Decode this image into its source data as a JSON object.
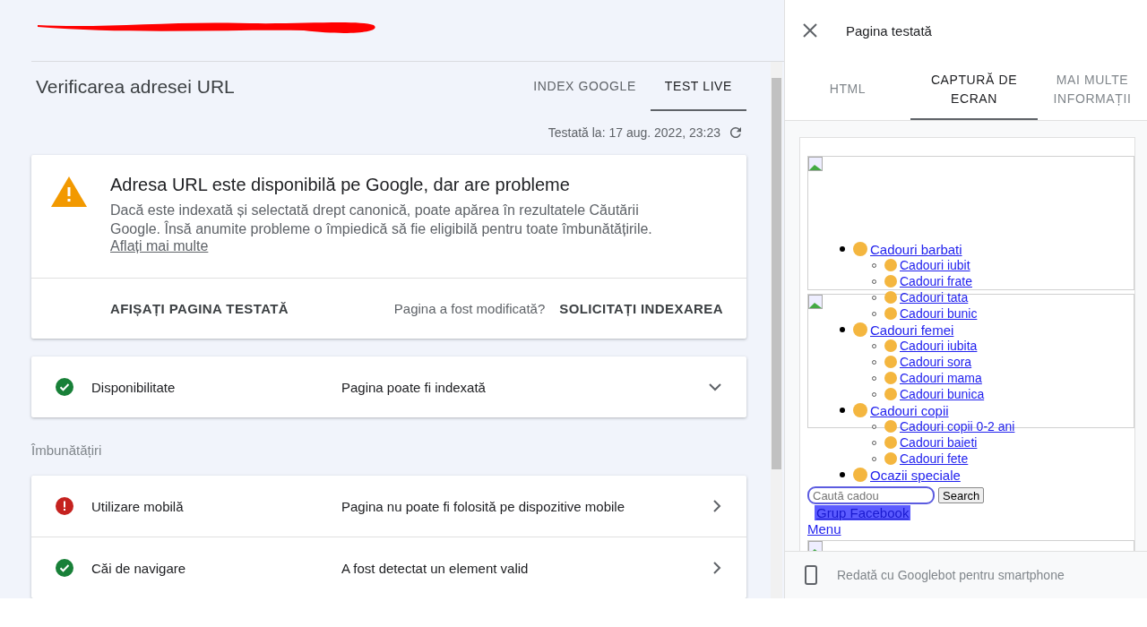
{
  "header": {
    "redacted_url": true
  },
  "inspection": {
    "title": "Verificarea adresei URL",
    "tabs": [
      {
        "label": "INDEX GOOGLE",
        "selected": false
      },
      {
        "label": "TEST LIVE",
        "selected": true
      }
    ],
    "tested_at": "Testată la: 17 aug. 2022, 23:23",
    "summary": {
      "has_issues": true,
      "heading": "Adresa URL este disponibilă pe Google, dar are probleme",
      "text": "Dacă este indexată și selectată drept canonică, poate apărea în rezultatele Căutării Google. Însă anumite probleme o împiedică să fie eligibilă pentru toate îmbunătățirile.",
      "link": "Aflați mai multe",
      "view_button": "AFIȘAȚI PAGINA TESTATĂ",
      "question": "Pagina a fost modificată?",
      "request_button": "SOLICITAȚI INDEXAREA"
    },
    "availability": [
      {
        "kind": "valid",
        "label": "Disponibilitate",
        "value": "Pagina poate fi indexată",
        "expandable": true
      }
    ],
    "enhancements_heading": "Îmbunătățiri",
    "enhancements": [
      {
        "kind": "error",
        "label": "Utilizare mobilă",
        "value": "Pagina nu poate fi folosită pe dispozitive mobile",
        "expandable": false
      },
      {
        "kind": "valid",
        "label": "Căi de navigare",
        "value": "A fost detectat un element valid",
        "expandable": false
      }
    ]
  },
  "panel": {
    "title": "Pagina testată",
    "tabs": [
      {
        "label": "HTML",
        "selected": false
      },
      {
        "label": "CAPTURĂ DE ECRAN",
        "selected": true
      },
      {
        "label": "MAI MULTE INFORMAȚII",
        "selected": false
      }
    ],
    "screenshot": {
      "menu": [
        {
          "label": "Cadouri barbati",
          "children": [
            {
              "label": "Cadouri iubit"
            },
            {
              "label": "Cadouri frate"
            },
            {
              "label": "Cadouri tata"
            },
            {
              "label": "Cadouri bunic"
            }
          ]
        },
        {
          "label": "Cadouri femei",
          "children": [
            {
              "label": "Cadouri iubita"
            },
            {
              "label": "Cadouri sora"
            },
            {
              "label": "Cadouri mama"
            },
            {
              "label": "Cadouri bunica"
            }
          ]
        },
        {
          "label": "Cadouri copii",
          "children": [
            {
              "label": "Cadouri copii 0-2 ani"
            },
            {
              "label": "Cadouri baieti"
            },
            {
              "label": "Cadouri fete"
            }
          ]
        },
        {
          "label": "Ocazii speciale"
        }
      ],
      "search_placeholder": "Caută cadou",
      "search_button": "Search",
      "facebook_link": "Grup Facebook",
      "menu_link": "Menu"
    },
    "footer": "Redată cu Googlebot pentru smartphone"
  }
}
